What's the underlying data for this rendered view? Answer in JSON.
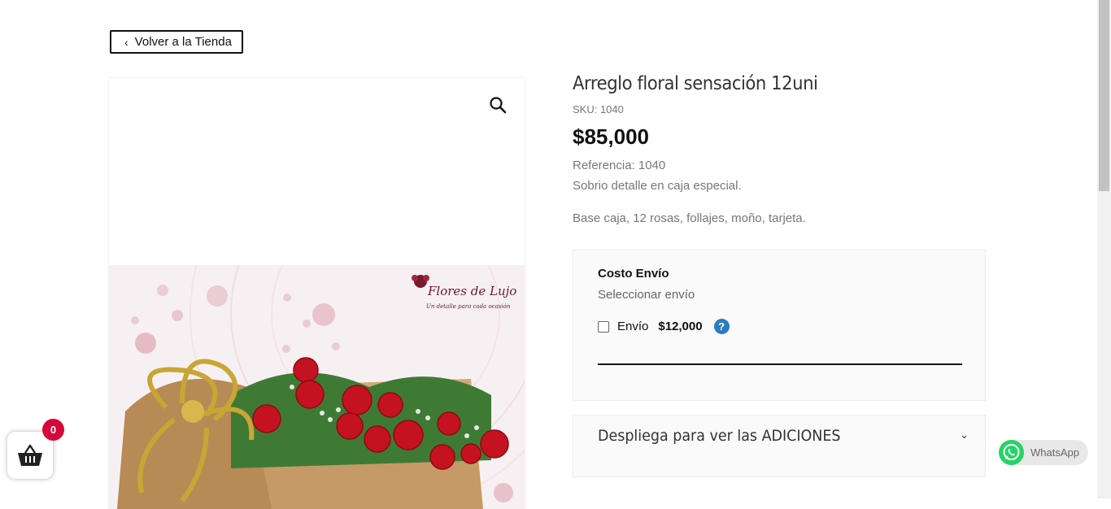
{
  "nav": {
    "back_label": "Volver a la Tienda"
  },
  "product": {
    "title": "Arreglo floral sensación 12uni",
    "sku": "SKU: 1040",
    "price": "$85,000",
    "reference": "Referencia: 1040",
    "description": "Sobrio detalle en caja especial.",
    "contents": "Base caja, 12 rosas, follajes, moño, tarjeta.",
    "image_brand": "Flores de Lujo",
    "image_tagline": "Un detalle para cada ocasión"
  },
  "shipping": {
    "heading": "Costo Envío",
    "select_label": "Seleccionar envío",
    "option_label": "Envío",
    "option_price": "$12,000",
    "option_checked": false,
    "help_glyph": "?"
  },
  "additions": {
    "label": "Despliega para ver las ADICIONES"
  },
  "cart": {
    "count": "0"
  },
  "whatsapp": {
    "label": "WhatsApp"
  },
  "colors": {
    "cart_badge": "#d6073b",
    "help_icon": "#2b7bc0",
    "whatsapp_green": "#25d366"
  },
  "icons": [
    "chevron-left-icon",
    "search-icon",
    "help-icon",
    "chevron-down-icon",
    "basket-icon",
    "whatsapp-icon"
  ]
}
